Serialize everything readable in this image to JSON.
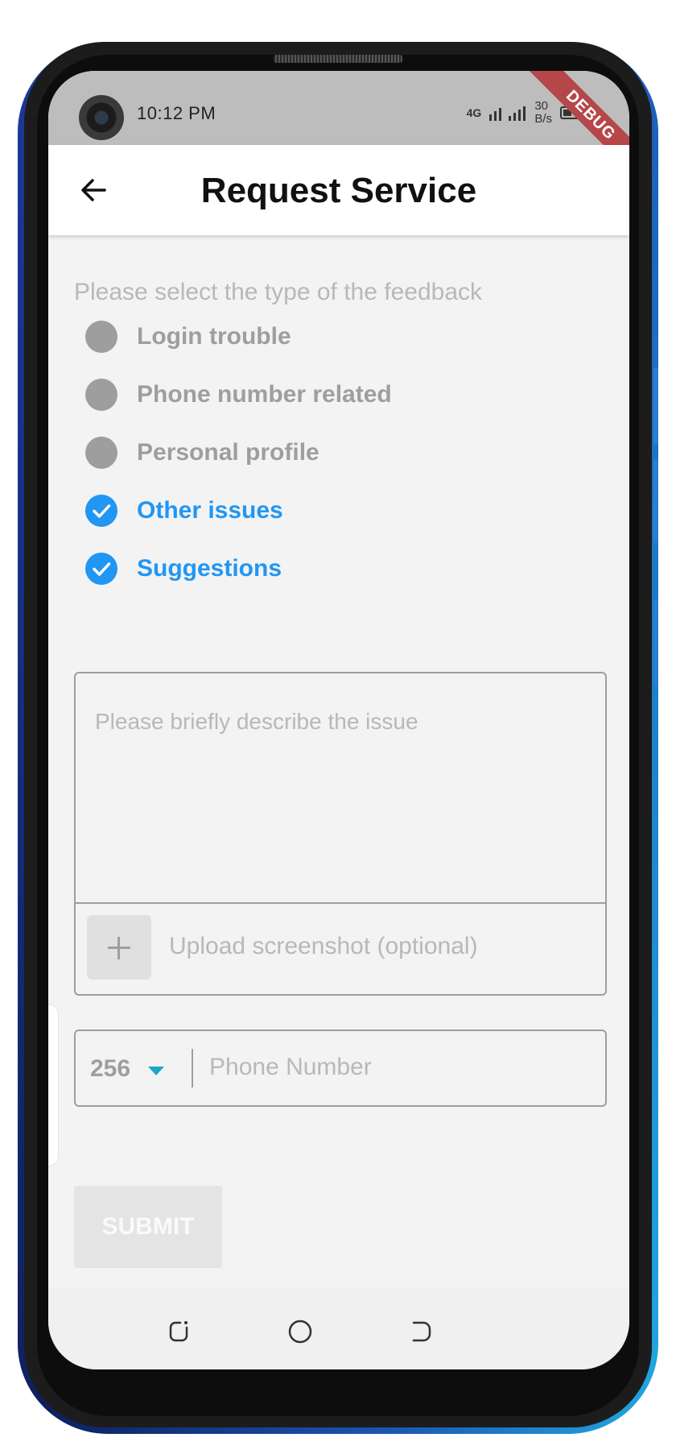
{
  "status_bar": {
    "time": "10:12 PM",
    "network": "4G",
    "speed_value": "30",
    "speed_unit": "B/s",
    "debug_banner": "DEBUG"
  },
  "app_bar": {
    "title": "Request Service",
    "back_icon": "arrow-back-icon"
  },
  "form": {
    "prompt": "Please select the type of the feedback",
    "options": [
      {
        "label": "Login trouble",
        "checked": false
      },
      {
        "label": "Phone number related",
        "checked": false
      },
      {
        "label": "Personal profile",
        "checked": false
      },
      {
        "label": "Other issues",
        "checked": true
      },
      {
        "label": "Suggestions",
        "checked": true
      }
    ],
    "description_placeholder": "Please briefly describe the issue",
    "upload_label": "Upload screenshot (optional)",
    "country_code": "256",
    "phone_placeholder": "Phone Number",
    "submit_label": "SUBMIT"
  },
  "colors": {
    "accent": "#2196f3",
    "unchecked": "#9e9e9e",
    "caret": "#1ba8c4"
  }
}
